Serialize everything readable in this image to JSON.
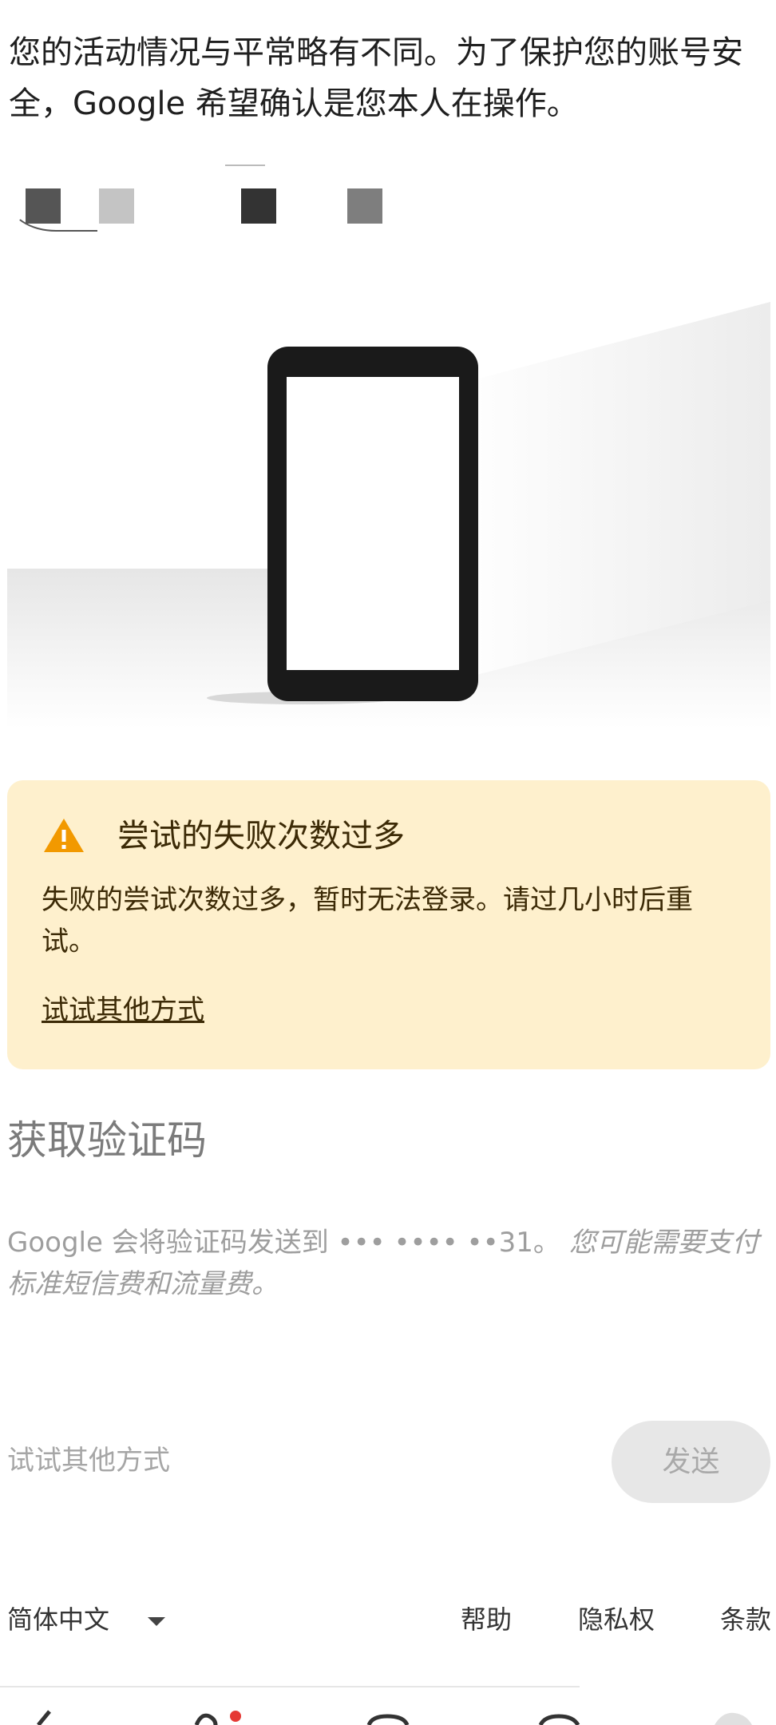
{
  "intro_text": "您的活动情况与平常略有不同。为了保护您的账号安全，Google 希望确认是您本人在操作。",
  "tile_colors": [
    "#555555",
    "#c4c4c4",
    "#333333",
    "#7e7e7e"
  ],
  "alert": {
    "title": "尝试的失败次数过多",
    "body": "失败的尝试次数过多，暂时无法登录。请过几小时后重试。",
    "link": "试试其他方式",
    "background": "#fef0cd",
    "icon_color": "#f29900"
  },
  "section_title": "获取验证码",
  "description": {
    "text": "Google 会将验证码发送到 ••• •••• ••31。",
    "note": "您可能需要支付标准短信费和流量费。"
  },
  "actions": {
    "try_other": "试试其他方式",
    "send": "发送"
  },
  "footer": {
    "language": "简体中文",
    "help": "帮助",
    "privacy": "隐私权",
    "terms": "条款"
  }
}
